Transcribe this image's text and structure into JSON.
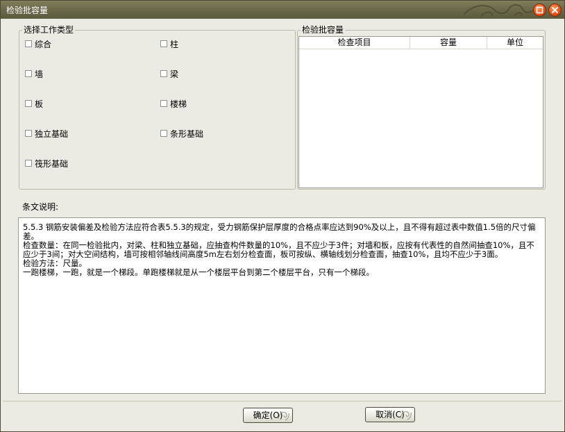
{
  "window": {
    "title": "检验批容量"
  },
  "work_type_group": {
    "title": "选择工作类型",
    "items": [
      {
        "label": "综合",
        "checked": false
      },
      {
        "label": "柱",
        "checked": false
      },
      {
        "label": "墙",
        "checked": false
      },
      {
        "label": "梁",
        "checked": false
      },
      {
        "label": "板",
        "checked": false
      },
      {
        "label": "楼梯",
        "checked": false
      },
      {
        "label": "独立基础",
        "checked": false
      },
      {
        "label": "条形基础",
        "checked": false
      },
      {
        "label": "筏形基础",
        "checked": false
      }
    ]
  },
  "capacity_group": {
    "title": "检验批容量",
    "columns": [
      "检查项目",
      "容量",
      "单位"
    ],
    "rows": []
  },
  "description": {
    "label": "条文说明:",
    "paragraphs": [
      "5.5.3  钢筋安装偏差及检验方法应符合表5.5.3的规定，受力钢筋保护层厚度的合格点率应达到90%及以上，且不得有超过表中数值1.5倍的尺寸偏差。",
      "检查数量：在同一检验批内，对梁、柱和独立基础，应抽查构件数量的10%，且不应少于3件；对墙和板，应按有代表性的自然间抽查10%，且不应少于3间；对大空间结构，墙可按相邻轴线间高度5m左右划分检查面，板可按纵、横轴线划分检查面，抽查10%，且均不应少于3面。",
      "检验方法：尺量。",
      "一跑楼梯，一跑，就是一个梯段。单跑楼梯就是从一个楼层平台到第二个楼层平台，只有一个梯段。"
    ]
  },
  "buttons": {
    "ok": "确定(O)",
    "cancel": "取消(C)"
  },
  "colors": {
    "titlebar": "#6d6b4c",
    "close_button": "#e0501a",
    "window_bg": "#ecebe3"
  }
}
